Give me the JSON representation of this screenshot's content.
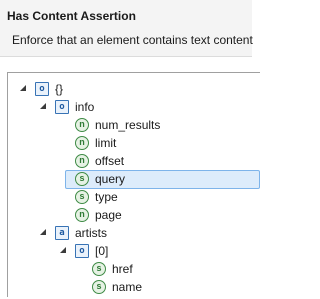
{
  "header": {
    "title": "Has Content Assertion",
    "description": "Enforce that an element contains text content"
  },
  "tree": {
    "nodes": [
      {
        "label": "{}",
        "icon": "object-icon",
        "icon_text": "o",
        "expanded": true,
        "selected": false
      },
      {
        "label": "info",
        "icon": "object-icon",
        "icon_text": "o",
        "expanded": true,
        "selected": false
      },
      {
        "label": "num_results",
        "icon": "number-icon",
        "icon_text": "n",
        "expanded": false,
        "selected": false
      },
      {
        "label": "limit",
        "icon": "number-icon",
        "icon_text": "n",
        "expanded": false,
        "selected": false
      },
      {
        "label": "offset",
        "icon": "number-icon",
        "icon_text": "n",
        "expanded": false,
        "selected": false
      },
      {
        "label": "query",
        "icon": "string-icon",
        "icon_text": "s",
        "expanded": false,
        "selected": true
      },
      {
        "label": "type",
        "icon": "string-icon",
        "icon_text": "s",
        "expanded": false,
        "selected": false
      },
      {
        "label": "page",
        "icon": "number-icon",
        "icon_text": "n",
        "expanded": false,
        "selected": false
      },
      {
        "label": "artists",
        "icon": "array-icon",
        "icon_text": "a",
        "expanded": true,
        "selected": false
      },
      {
        "label": "[0]",
        "icon": "object-icon",
        "icon_text": "o",
        "expanded": true,
        "selected": false
      },
      {
        "label": "href",
        "icon": "string-icon",
        "icon_text": "s",
        "expanded": false,
        "selected": false
      },
      {
        "label": "name",
        "icon": "string-icon",
        "icon_text": "s",
        "expanded": false,
        "selected": false
      }
    ]
  }
}
